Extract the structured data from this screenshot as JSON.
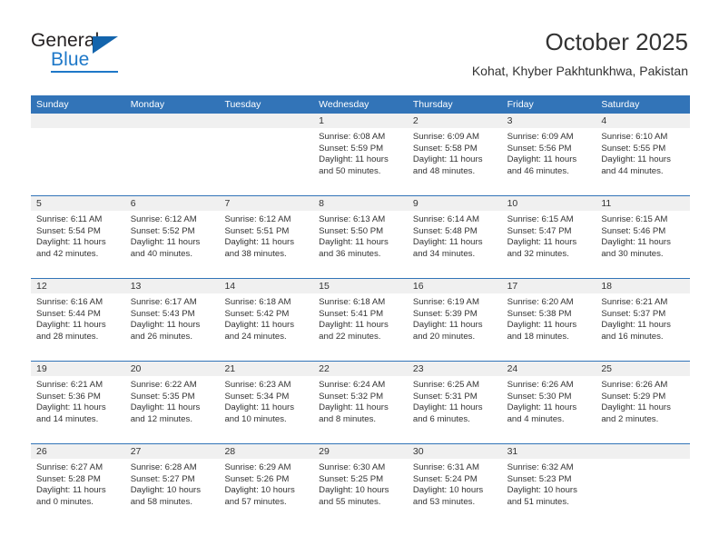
{
  "logo": {
    "word1": "General",
    "word2": "Blue",
    "triangle_color": "#1364ac",
    "blue_color": "#1e78c8"
  },
  "header": {
    "title": "October 2025",
    "subtitle": "Kohat, Khyber Pakhtunkhwa, Pakistan"
  },
  "theme": {
    "header_blue": "#3274b8",
    "date_band_gray": "#f0f0f0",
    "text_color": "#333333"
  },
  "calendar": {
    "day_headers": [
      "Sunday",
      "Monday",
      "Tuesday",
      "Wednesday",
      "Thursday",
      "Friday",
      "Saturday"
    ],
    "weeks": [
      [
        {
          "day": "",
          "lines": []
        },
        {
          "day": "",
          "lines": []
        },
        {
          "day": "",
          "lines": []
        },
        {
          "day": "1",
          "lines": [
            "Sunrise: 6:08 AM",
            "Sunset: 5:59 PM",
            "Daylight: 11 hours",
            "and 50 minutes."
          ]
        },
        {
          "day": "2",
          "lines": [
            "Sunrise: 6:09 AM",
            "Sunset: 5:58 PM",
            "Daylight: 11 hours",
            "and 48 minutes."
          ]
        },
        {
          "day": "3",
          "lines": [
            "Sunrise: 6:09 AM",
            "Sunset: 5:56 PM",
            "Daylight: 11 hours",
            "and 46 minutes."
          ]
        },
        {
          "day": "4",
          "lines": [
            "Sunrise: 6:10 AM",
            "Sunset: 5:55 PM",
            "Daylight: 11 hours",
            "and 44 minutes."
          ]
        }
      ],
      [
        {
          "day": "5",
          "lines": [
            "Sunrise: 6:11 AM",
            "Sunset: 5:54 PM",
            "Daylight: 11 hours",
            "and 42 minutes."
          ]
        },
        {
          "day": "6",
          "lines": [
            "Sunrise: 6:12 AM",
            "Sunset: 5:52 PM",
            "Daylight: 11 hours",
            "and 40 minutes."
          ]
        },
        {
          "day": "7",
          "lines": [
            "Sunrise: 6:12 AM",
            "Sunset: 5:51 PM",
            "Daylight: 11 hours",
            "and 38 minutes."
          ]
        },
        {
          "day": "8",
          "lines": [
            "Sunrise: 6:13 AM",
            "Sunset: 5:50 PM",
            "Daylight: 11 hours",
            "and 36 minutes."
          ]
        },
        {
          "day": "9",
          "lines": [
            "Sunrise: 6:14 AM",
            "Sunset: 5:48 PM",
            "Daylight: 11 hours",
            "and 34 minutes."
          ]
        },
        {
          "day": "10",
          "lines": [
            "Sunrise: 6:15 AM",
            "Sunset: 5:47 PM",
            "Daylight: 11 hours",
            "and 32 minutes."
          ]
        },
        {
          "day": "11",
          "lines": [
            "Sunrise: 6:15 AM",
            "Sunset: 5:46 PM",
            "Daylight: 11 hours",
            "and 30 minutes."
          ]
        }
      ],
      [
        {
          "day": "12",
          "lines": [
            "Sunrise: 6:16 AM",
            "Sunset: 5:44 PM",
            "Daylight: 11 hours",
            "and 28 minutes."
          ]
        },
        {
          "day": "13",
          "lines": [
            "Sunrise: 6:17 AM",
            "Sunset: 5:43 PM",
            "Daylight: 11 hours",
            "and 26 minutes."
          ]
        },
        {
          "day": "14",
          "lines": [
            "Sunrise: 6:18 AM",
            "Sunset: 5:42 PM",
            "Daylight: 11 hours",
            "and 24 minutes."
          ]
        },
        {
          "day": "15",
          "lines": [
            "Sunrise: 6:18 AM",
            "Sunset: 5:41 PM",
            "Daylight: 11 hours",
            "and 22 minutes."
          ]
        },
        {
          "day": "16",
          "lines": [
            "Sunrise: 6:19 AM",
            "Sunset: 5:39 PM",
            "Daylight: 11 hours",
            "and 20 minutes."
          ]
        },
        {
          "day": "17",
          "lines": [
            "Sunrise: 6:20 AM",
            "Sunset: 5:38 PM",
            "Daylight: 11 hours",
            "and 18 minutes."
          ]
        },
        {
          "day": "18",
          "lines": [
            "Sunrise: 6:21 AM",
            "Sunset: 5:37 PM",
            "Daylight: 11 hours",
            "and 16 minutes."
          ]
        }
      ],
      [
        {
          "day": "19",
          "lines": [
            "Sunrise: 6:21 AM",
            "Sunset: 5:36 PM",
            "Daylight: 11 hours",
            "and 14 minutes."
          ]
        },
        {
          "day": "20",
          "lines": [
            "Sunrise: 6:22 AM",
            "Sunset: 5:35 PM",
            "Daylight: 11 hours",
            "and 12 minutes."
          ]
        },
        {
          "day": "21",
          "lines": [
            "Sunrise: 6:23 AM",
            "Sunset: 5:34 PM",
            "Daylight: 11 hours",
            "and 10 minutes."
          ]
        },
        {
          "day": "22",
          "lines": [
            "Sunrise: 6:24 AM",
            "Sunset: 5:32 PM",
            "Daylight: 11 hours",
            "and 8 minutes."
          ]
        },
        {
          "day": "23",
          "lines": [
            "Sunrise: 6:25 AM",
            "Sunset: 5:31 PM",
            "Daylight: 11 hours",
            "and 6 minutes."
          ]
        },
        {
          "day": "24",
          "lines": [
            "Sunrise: 6:26 AM",
            "Sunset: 5:30 PM",
            "Daylight: 11 hours",
            "and 4 minutes."
          ]
        },
        {
          "day": "25",
          "lines": [
            "Sunrise: 6:26 AM",
            "Sunset: 5:29 PM",
            "Daylight: 11 hours",
            "and 2 minutes."
          ]
        }
      ],
      [
        {
          "day": "26",
          "lines": [
            "Sunrise: 6:27 AM",
            "Sunset: 5:28 PM",
            "Daylight: 11 hours",
            "and 0 minutes."
          ]
        },
        {
          "day": "27",
          "lines": [
            "Sunrise: 6:28 AM",
            "Sunset: 5:27 PM",
            "Daylight: 10 hours",
            "and 58 minutes."
          ]
        },
        {
          "day": "28",
          "lines": [
            "Sunrise: 6:29 AM",
            "Sunset: 5:26 PM",
            "Daylight: 10 hours",
            "and 57 minutes."
          ]
        },
        {
          "day": "29",
          "lines": [
            "Sunrise: 6:30 AM",
            "Sunset: 5:25 PM",
            "Daylight: 10 hours",
            "and 55 minutes."
          ]
        },
        {
          "day": "30",
          "lines": [
            "Sunrise: 6:31 AM",
            "Sunset: 5:24 PM",
            "Daylight: 10 hours",
            "and 53 minutes."
          ]
        },
        {
          "day": "31",
          "lines": [
            "Sunrise: 6:32 AM",
            "Sunset: 5:23 PM",
            "Daylight: 10 hours",
            "and 51 minutes."
          ]
        },
        {
          "day": "",
          "lines": []
        }
      ]
    ]
  }
}
